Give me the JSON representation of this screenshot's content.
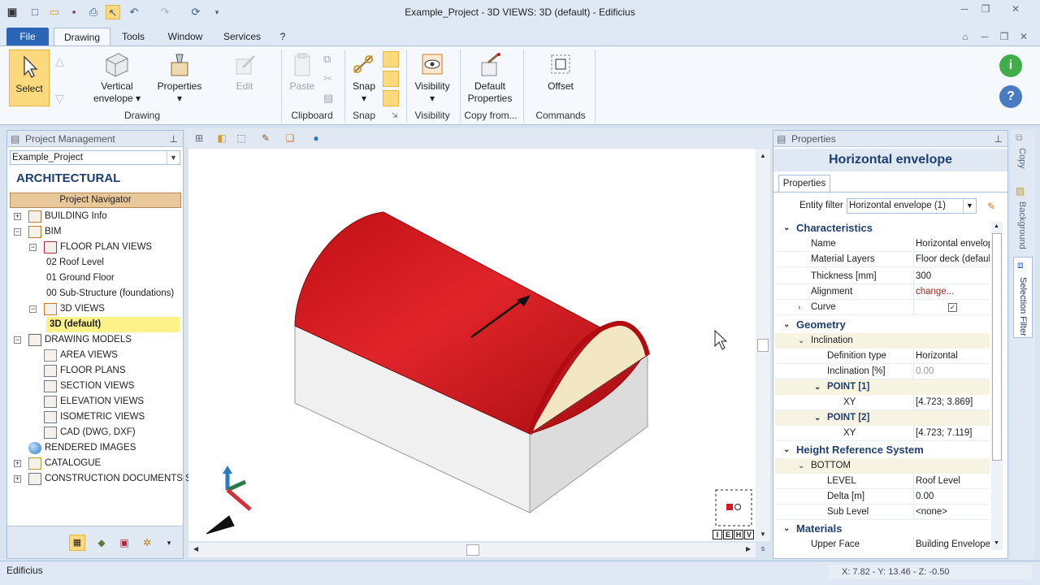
{
  "window": {
    "title": "Example_Project -  3D VIEWS: 3D (default) - Edificius"
  },
  "menu_tabs": [
    "File",
    "Drawing",
    "Tools",
    "Window",
    "Services",
    "?"
  ],
  "ribbon": {
    "select": "Select",
    "vertical_envelope": "Vertical envelope",
    "properties": "Properties",
    "edit": "Edit",
    "paste": "Paste",
    "snap": "Snap",
    "visibility": "Visibility",
    "default_properties": "Default Properties",
    "offset": "Offset",
    "groups": {
      "drawing": "Drawing",
      "clipboard": "Clipboard",
      "snap": "Snap",
      "visibility": "Visibility",
      "copy_from": "Copy from...",
      "commands": "Commands"
    }
  },
  "left_panel": {
    "header": "Project Management",
    "project_select": "Example_Project",
    "section_title": "ARCHITECTURAL",
    "navigator_label": "Project Navigator",
    "tree": [
      {
        "label": "BUILDING Info",
        "level": 0,
        "expander": "+",
        "icon": "building-icon"
      },
      {
        "label": "BIM",
        "level": 0,
        "expander": "-",
        "icon": "bim-icon"
      },
      {
        "label": "FLOOR PLAN VIEWS",
        "level": 1,
        "expander": "-",
        "icon": "floor-plan-icon"
      },
      {
        "label": "02 Roof Level",
        "level": 2,
        "expander": "",
        "icon": ""
      },
      {
        "label": "01 Ground Floor",
        "level": 2,
        "expander": "",
        "icon": ""
      },
      {
        "label": "00 Sub-Structure (foundations)",
        "level": 2,
        "expander": "",
        "icon": ""
      },
      {
        "label": "3D VIEWS",
        "level": 1,
        "expander": "-",
        "icon": "3d-icon"
      },
      {
        "label": "3D (default)",
        "level": 2,
        "expander": "",
        "icon": "",
        "selected": true
      },
      {
        "label": "DRAWING MODELS",
        "level": 0,
        "expander": "-",
        "icon": "drawing-models-icon"
      },
      {
        "label": "AREA VIEWS",
        "level": 1,
        "expander": "",
        "icon": "area-views-icon"
      },
      {
        "label": "FLOOR PLANS",
        "level": 1,
        "expander": "",
        "icon": "floor-plans-icon"
      },
      {
        "label": "SECTION VIEWS",
        "level": 1,
        "expander": "",
        "icon": "section-views-icon"
      },
      {
        "label": "ELEVATION VIEWS",
        "level": 1,
        "expander": "",
        "icon": "elevation-views-icon"
      },
      {
        "label": "ISOMETRIC VIEWS",
        "level": 1,
        "expander": "",
        "icon": "isometric-views-icon"
      },
      {
        "label": "CAD (DWG, DXF)",
        "level": 1,
        "expander": "",
        "icon": "cad-icon"
      },
      {
        "label": "RENDERED IMAGES",
        "level": 0,
        "expander": "",
        "icon": "rendered-images-icon"
      },
      {
        "label": "CATALOGUE",
        "level": 0,
        "expander": "+",
        "icon": "catalogue-icon"
      },
      {
        "label": "CONSTRUCTION DOCUMENTS SET",
        "level": 0,
        "expander": "+",
        "icon": "construction-docs-icon"
      }
    ]
  },
  "viewport": {
    "view_cube_labels": [
      "I",
      "E",
      "H",
      "V"
    ]
  },
  "properties_panel": {
    "header": "Properties",
    "entity_title": "Horizontal envelope",
    "tab": "Properties",
    "entity_filter_label": "Entity filter",
    "entity_filter_value": "Horizontal envelope (1)",
    "sections": {
      "characteristics": "Characteristics",
      "geometry": "Geometry",
      "height_ref": "Height Reference System",
      "materials": "Materials"
    },
    "rows": {
      "name": {
        "k": "Name",
        "v": "Horizontal envelope"
      },
      "material_layers": {
        "k": "Material Layers",
        "v": "Floor deck (default"
      },
      "thickness": {
        "k": "Thickness  [mm]",
        "v": "300"
      },
      "alignment": {
        "k": "Alignment",
        "v": "change..."
      },
      "curve": {
        "k": "Curve",
        "v": ""
      },
      "inclination_group": {
        "k": "Inclination"
      },
      "definition_type": {
        "k": "Definition type",
        "v": "Horizontal"
      },
      "inclination": {
        "k": "Inclination  [%]",
        "v": "0.00"
      },
      "point1": {
        "k": "POINT [1]"
      },
      "xy1": {
        "k": "XY",
        "v": "[4.723; 3.869]"
      },
      "point2": {
        "k": "POINT [2]"
      },
      "xy2": {
        "k": "XY",
        "v": "[4.723; 7.119]"
      },
      "bottom": {
        "k": "BOTTOM"
      },
      "level": {
        "k": "LEVEL",
        "v": "Roof Level"
      },
      "delta": {
        "k": "Delta  [m]",
        "v": "0.00"
      },
      "sublevel": {
        "k": "Sub Level",
        "v": "<none>"
      },
      "upper_face": {
        "k": "Upper Face",
        "v": "Building Envelope ("
      }
    }
  },
  "right_strip": [
    "Copy",
    "Background",
    "Selection Filter"
  ],
  "status": {
    "app": "Edificius",
    "coords": "X: 7.82 - Y: 13.46 - Z: -0.50"
  },
  "colors": {
    "accent": "#2a65b8",
    "roof_red": "#d4181c",
    "selected_tree": "#fdf28a",
    "navigator": "#e8c79a"
  }
}
